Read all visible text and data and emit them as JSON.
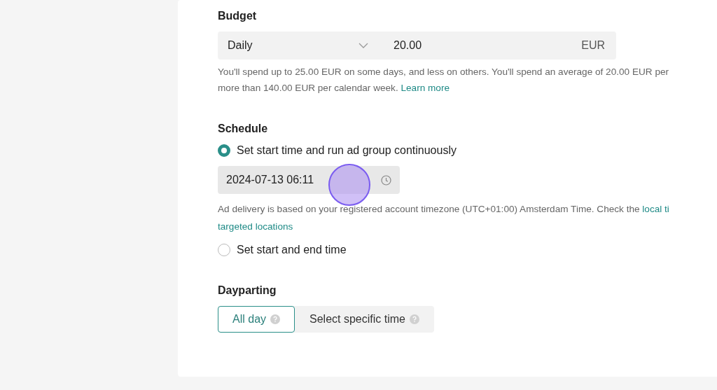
{
  "budget": {
    "heading": "Budget",
    "type_select": {
      "value": "Daily"
    },
    "amount_field": {
      "value": "20.00",
      "unit": "EUR"
    },
    "help": {
      "text": "You'll spend up to 25.00 EUR on some days, and less on others. You'll spend an average of 20.00 EUR per\nmore than 140.00 EUR per calendar week.",
      "link": "Learn more"
    }
  },
  "schedule": {
    "heading": "Schedule",
    "options": [
      {
        "label": "Set start time and run ad group continuously",
        "selected": true
      },
      {
        "label": "Set start and end time",
        "selected": false
      }
    ],
    "start_field": {
      "value": "2024-07-13 06:11"
    },
    "note": {
      "text": "Ad delivery is based on your registered account timezone (UTC+01:00) Amsterdam Time. Check the",
      "link": "local ti",
      "link_2": "targeted locations"
    }
  },
  "dayparting": {
    "heading": "Dayparting",
    "options": [
      {
        "label": "All day",
        "selected": true
      },
      {
        "label": "Select specific time",
        "selected": false
      }
    ]
  }
}
